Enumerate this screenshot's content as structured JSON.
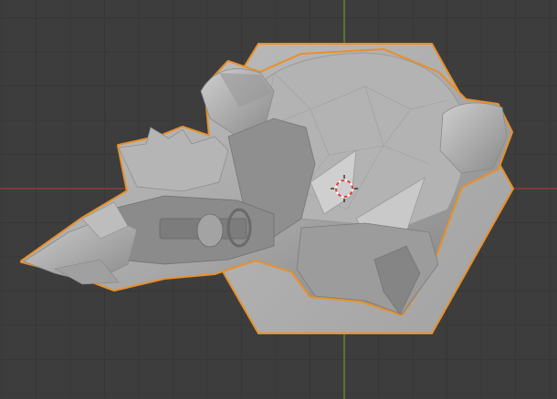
{
  "viewport": {
    "background": "#3d3d3d",
    "grid_minor_color": "#363636",
    "grid_major_color": "#2f2f2f",
    "x_axis_color": "#9c3a3a",
    "y_axis_color": "#6d8f2a",
    "selection_outline_color": "#e8902a",
    "mesh_color": "#a9a9a9",
    "mesh_shadow_color": "#7c7c7c",
    "mesh_highlight_color": "#c8c8c8",
    "cursor_ring_color": "#e04040"
  },
  "objects": [
    {
      "name": "hexagon-mesh",
      "selected": true
    },
    {
      "name": "character-mesh",
      "selected": true
    }
  ],
  "cursor": {
    "icon": "3d-cursor-icon"
  }
}
